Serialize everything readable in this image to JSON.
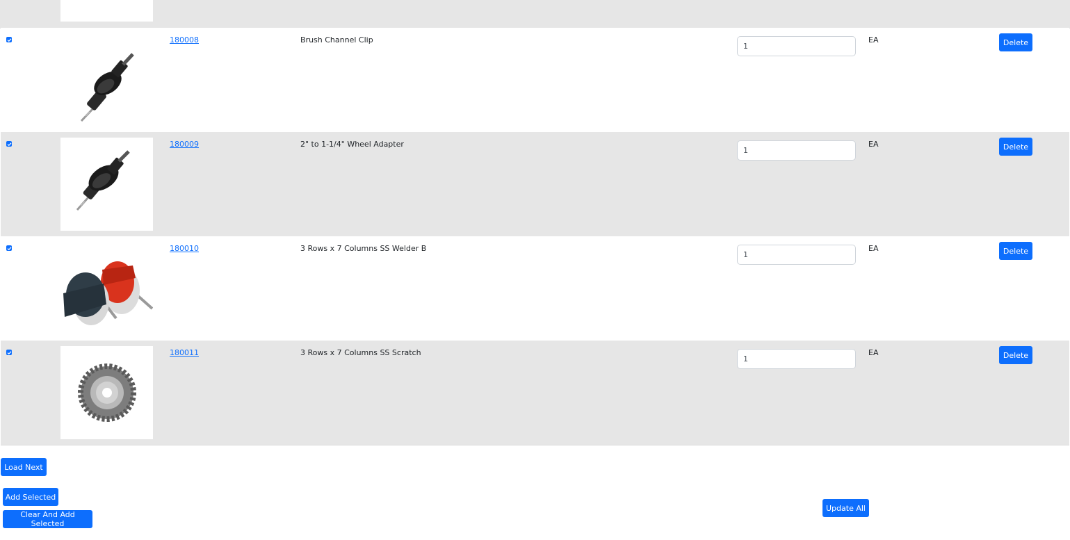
{
  "rows": [
    {
      "sku": "180008",
      "description": "Brush Channel Clip",
      "quantity": "1",
      "uom": "EA",
      "delete_label": "Delete",
      "image": "hole-saw-arbor",
      "checked": true
    },
    {
      "sku": "180009",
      "description": "2\" to 1-1/4\" Wheel Adapter",
      "quantity": "1",
      "uom": "EA",
      "delete_label": "Delete",
      "image": "hole-saw-arbor",
      "checked": true
    },
    {
      "sku": "180010",
      "description": "3 Rows x 7 Columns SS Welder B",
      "quantity": "1",
      "uom": "EA",
      "delete_label": "Delete",
      "image": "nylon-cup-brushes",
      "checked": true
    },
    {
      "sku": "180011",
      "description": "3 Rows x 7 Columns SS Scratch",
      "quantity": "1",
      "uom": "EA",
      "delete_label": "Delete",
      "image": "knotted-wire-wheel",
      "checked": true
    }
  ],
  "actions": {
    "load_next": "Load Next",
    "add_selected": "Add Selected",
    "clear_and_add_selected": "Clear And Add Selected",
    "update_all": "Update All"
  },
  "colors": {
    "accent": "#0d6efd",
    "row_shade": "#e6e6e6"
  }
}
